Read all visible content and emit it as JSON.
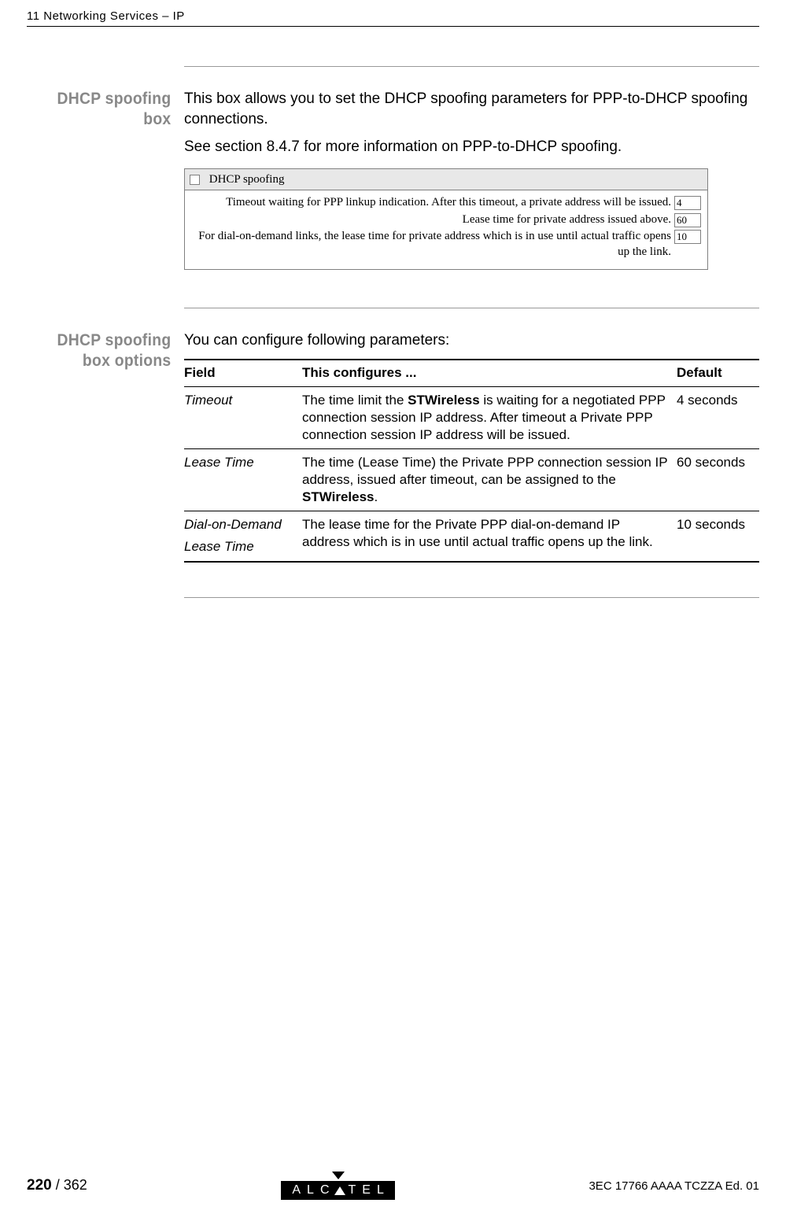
{
  "header": {
    "chapter": "11 Networking Services – IP"
  },
  "section1": {
    "heading": "DHCP spoofing box",
    "p1": "This box allows you to set the DHCP spoofing parameters for PPP-to-DHCP spoofing connections.",
    "p2": "See section 8.4.7 for more information on PPP-to-DHCP spoofing."
  },
  "spoofbox": {
    "title": "DHCP spoofing",
    "row1_label": "Timeout waiting for PPP linkup indication. After this timeout, a private address will be issued.",
    "row1_value": "4",
    "row2_label": "Lease time for private address issued above.",
    "row2_value": "60",
    "row3_label": "For dial-on-demand links, the lease time for private address which is in use until actual traffic opens up the link.",
    "row3_value": "10"
  },
  "section2": {
    "heading": "DHCP spoofing box options",
    "intro": "You can configure following parameters:",
    "th_field": "Field",
    "th_conf": "This configures ...",
    "th_def": "Default",
    "rows": [
      {
        "field": "Timeout",
        "conf_pre": "The time limit the ",
        "conf_bold": "STWireless",
        "conf_post": " is waiting for a negotiated PPP connection session IP address. After timeout a Private PPP connection session IP address will be issued.",
        "def": "4 seconds"
      },
      {
        "field": "Lease Time",
        "conf_pre": "The time (Lease Time) the Private PPP connection session IP address, issued after timeout, can be assigned to the ",
        "conf_bold": "STWireless",
        "conf_post": ".",
        "def": "60 seconds"
      },
      {
        "field_line1": "Dial-on-Demand",
        "field_line2": "Lease Time",
        "conf_pre": "The lease time for the Private PPP dial-on-demand IP address which is in use until actual traffic opens up the link.",
        "conf_bold": "",
        "conf_post": "",
        "def": "10 seconds"
      }
    ]
  },
  "footer": {
    "page_bold": "220",
    "page_total": " / 362",
    "logo_text1": "ALC",
    "logo_text2": "TEL",
    "docid": "3EC 17766 AAAA TCZZA Ed. 01"
  }
}
